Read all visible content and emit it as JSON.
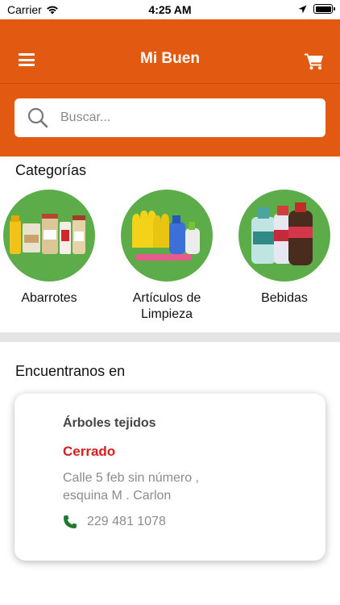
{
  "status_bar": {
    "carrier": "Carrier",
    "time": "4:25 AM",
    "icons": [
      "wifi-icon",
      "location-arrow-icon",
      "battery-icon"
    ]
  },
  "header": {
    "title": "Mi Buen",
    "menu_icon": "hamburger-menu-icon",
    "cart_icon": "shopping-cart-icon",
    "background_color": "#e25a12"
  },
  "search": {
    "placeholder": "Buscar...",
    "value": ""
  },
  "categories": {
    "title": "Categorías",
    "items": [
      {
        "label": "Abarrotes",
        "icon": "groceries-image"
      },
      {
        "label": "Artículos de Limpieza",
        "icon": "cleaning-supplies-image"
      },
      {
        "label": "Bebidas",
        "icon": "beverages-image"
      }
    ],
    "circle_color": "#5cad4a"
  },
  "locations": {
    "title": "Encuentranos en",
    "store": {
      "name": "Árboles tejidos",
      "status": "Cerrado",
      "status_color": "#d71d1d",
      "address_line1": "Calle 5 feb sin número ,",
      "address_line2": "esquina M . Carlon",
      "phone": "229 481 1078",
      "phone_icon": "phone-icon"
    }
  }
}
